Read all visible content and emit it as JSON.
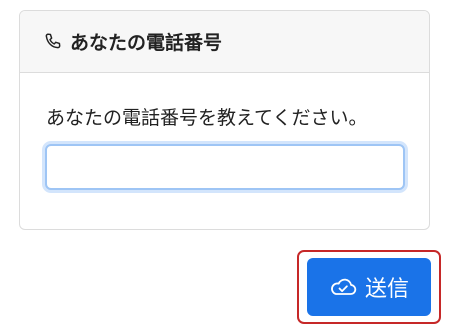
{
  "card": {
    "title": "あなたの電話番号",
    "header_icon": "phone-icon",
    "prompt": "あなたの電話番号を教えてください。",
    "input_value": ""
  },
  "actions": {
    "send_label": "送信",
    "send_icon": "cloud-check-icon",
    "highlight_color": "#c62828",
    "button_color": "#1a73e8"
  }
}
